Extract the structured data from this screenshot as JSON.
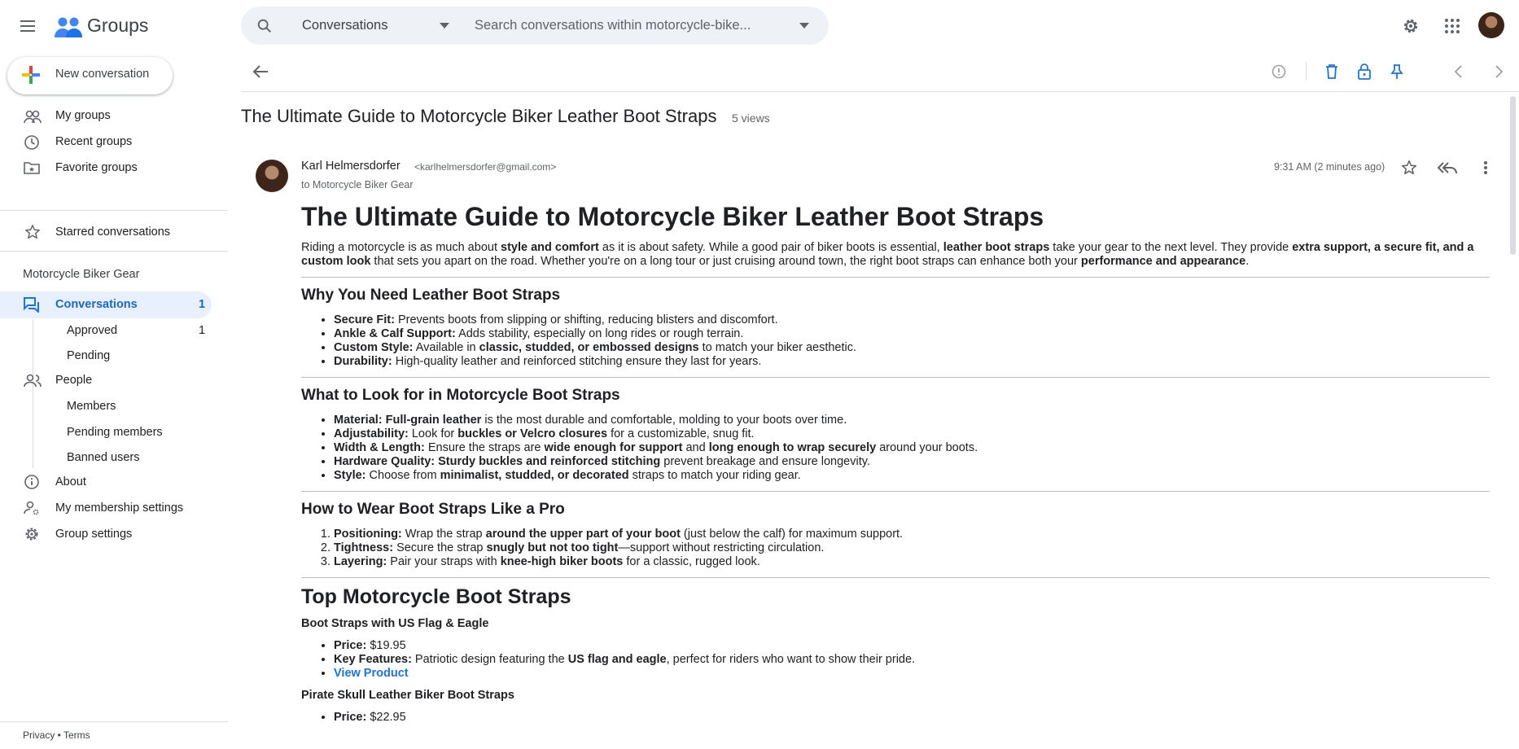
{
  "app": {
    "name": "Groups"
  },
  "search": {
    "scope": "Conversations",
    "placeholder": "Search conversations within motorcycle-bike..."
  },
  "sidebar": {
    "new_conversation": "New conversation",
    "items": {
      "my_groups": "My groups",
      "recent_groups": "Recent groups",
      "favorite_groups": "Favorite groups",
      "starred": "Starred conversations"
    },
    "group_name": "Motorcycle Biker Gear",
    "conversations": {
      "label": "Conversations",
      "count": "1"
    },
    "approved": {
      "label": "Approved",
      "count": "1"
    },
    "pending": "Pending",
    "people": "People",
    "members": "Members",
    "pending_members": "Pending members",
    "banned_users": "Banned users",
    "about": "About",
    "membership_settings": "My membership settings",
    "group_settings": "Group settings",
    "footer": "Privacy • Terms"
  },
  "thread": {
    "title": "The Ultimate Guide to Motorcycle Biker Leather Boot Straps",
    "views": "5 views"
  },
  "message": {
    "author": "Karl Helmersdorfer",
    "email": "<karlhelmersdorfer@gmail.com>",
    "to": "to Motorcycle Biker Gear",
    "time": "9:31 AM (2 minutes ago)"
  },
  "body": {
    "h1": "The Ultimate Guide to Motorcycle Biker Leather Boot Straps",
    "intro": [
      "Riding a motorcycle is as much about ",
      "style and comfort",
      " as it is about safety. While a good pair of biker boots is essential, ",
      "leather boot straps",
      " take your gear to the next level. They provide ",
      "extra support, a secure fit, and a custom look",
      " that sets you apart on the road. Whether you're on a long tour or just cruising around town, the right boot straps can enhance both your ",
      "performance and appearance",
      "."
    ],
    "s1": {
      "title": "Why You Need Leather Boot Straps",
      "items": [
        {
          "k": "Secure Fit:",
          "t": " Prevents boots from slipping or shifting, reducing blisters and discomfort."
        },
        {
          "k": "Ankle & Calf Support:",
          "t": " Adds stability, especially on long rides or rough terrain."
        },
        {
          "k": "Custom Style:",
          "t1": " Available in ",
          "b": "classic, studded, or embossed designs",
          "t2": " to match your biker aesthetic."
        },
        {
          "k": "Durability:",
          "t": " High-quality leather and reinforced stitching ensure they last for years."
        }
      ]
    },
    "s2": {
      "title": "What to Look for in Motorcycle Boot Straps",
      "items": [
        {
          "k": "Material:",
          "b": " Full-grain leather",
          "t": " is the most durable and comfortable, molding to your boots over time."
        },
        {
          "k": "Adjustability:",
          "t1": " Look for ",
          "b": "buckles or Velcro closures",
          "t2": " for a customizable, snug fit."
        },
        {
          "k": "Width & Length:",
          "t1": " Ensure the straps are ",
          "b": "wide enough for support",
          "t2": " and ",
          "b2": "long enough to wrap securely",
          "t3": " around your boots."
        },
        {
          "k": "Hardware Quality:",
          "b": " Sturdy buckles and reinforced stitching",
          "t": " prevent breakage and ensure longevity."
        },
        {
          "k": "Style:",
          "t1": " Choose from ",
          "b": "minimalist, studded, or decorated",
          "t2": " straps to match your riding gear."
        }
      ]
    },
    "s3": {
      "title": "How to Wear Boot Straps Like a Pro",
      "items": [
        {
          "k": "Positioning:",
          "t1": " Wrap the strap ",
          "b": "around the upper part of your boot",
          "t2": " (just below the calf) for maximum support."
        },
        {
          "k": "Tightness:",
          "t1": " Secure the strap ",
          "b": "snugly but not too tight",
          "t2": "—support without restricting circulation."
        },
        {
          "k": "Layering:",
          "t1": " Pair your straps with ",
          "b": "knee-high biker boots",
          "t2": " for a classic, rugged look."
        }
      ]
    },
    "s4": {
      "title": "Top Motorcycle Boot Straps",
      "p1": {
        "name": "Boot Straps with US Flag & Eagle",
        "price_k": "Price:",
        "price": " $19.95",
        "feat_k": "Key Features:",
        "feat1": " Patriotic design featuring the ",
        "feat_b": "US flag and eagle",
        "feat2": ", perfect for riders who want to show their pride.",
        "link": "View Product"
      },
      "p2": {
        "name": "Pirate Skull Leather Biker Boot Straps",
        "price_k": "Price:",
        "price": " $22.95"
      }
    }
  }
}
